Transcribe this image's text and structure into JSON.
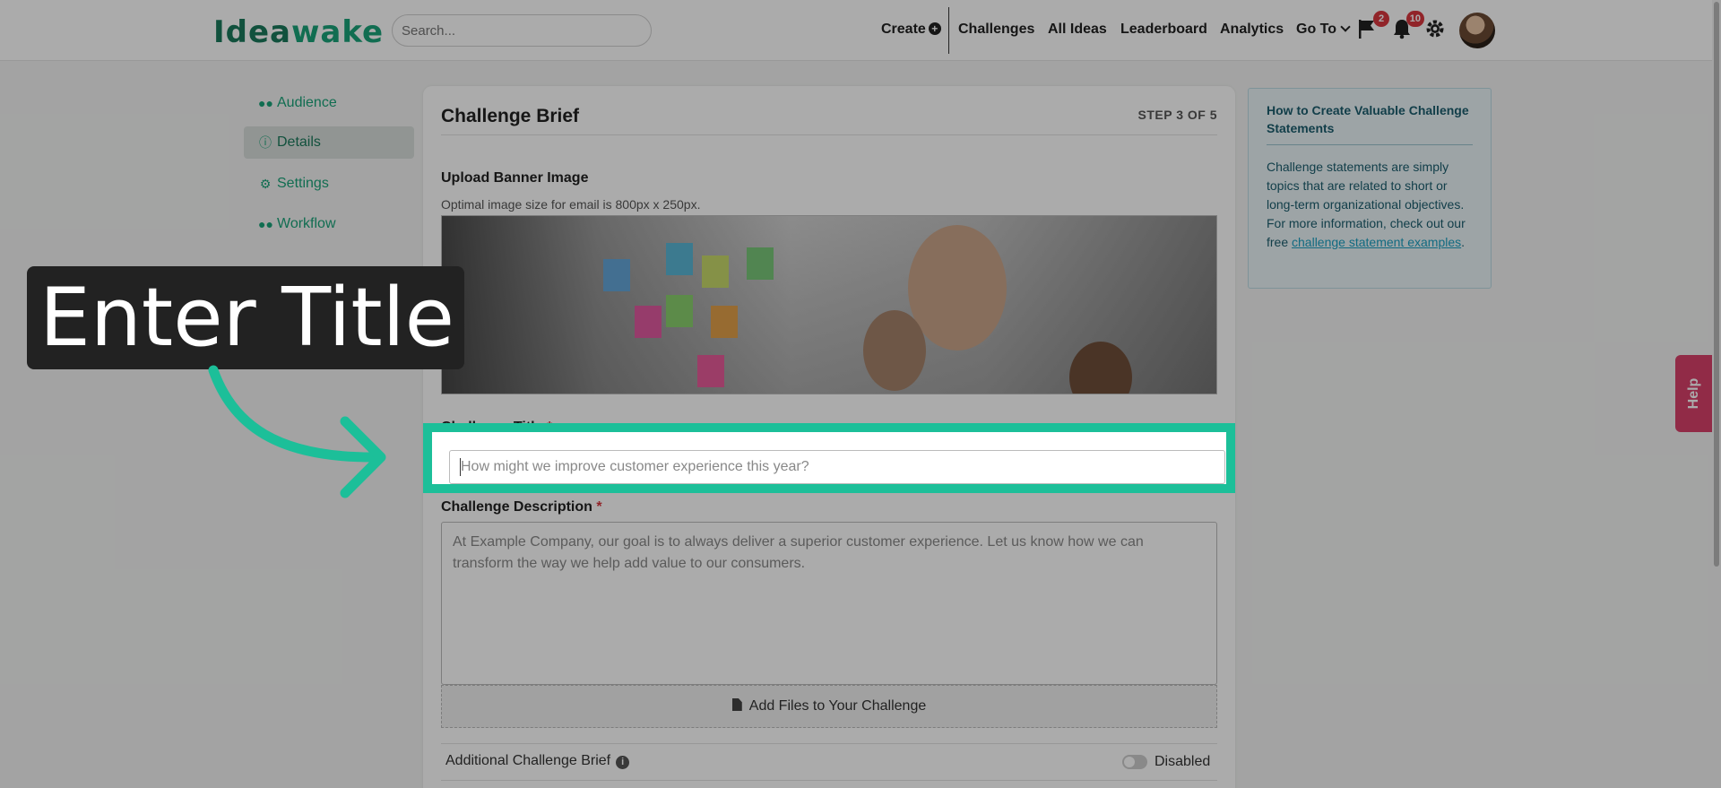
{
  "brand": {
    "logo_text_a": "Idea",
    "logo_text_b": "wake",
    "accent": "#1aa37a",
    "highlight": "#1cbf99"
  },
  "header": {
    "search_placeholder": "Search...",
    "create": "Create",
    "nav": [
      "Challenges",
      "All Ideas",
      "Leaderboard",
      "Analytics"
    ],
    "goto": "Go To",
    "flag_count": "2",
    "bell_count": "10"
  },
  "sidebar": {
    "items": [
      {
        "label": "Audience",
        "icon": "users-icon"
      },
      {
        "label": "Details",
        "icon": "info-icon",
        "active": true
      },
      {
        "label": "Settings",
        "icon": "gear-icon"
      },
      {
        "label": "Workflow",
        "icon": "workflow-icon"
      }
    ]
  },
  "main": {
    "title": "Challenge Brief",
    "step": "STEP 3 OF 5",
    "banner_label": "Upload Banner Image",
    "banner_hint": "Optimal image size for email is 800px x 250px.",
    "title_label": "Challenge Title",
    "title_placeholder": "How might we improve customer experience this year?",
    "description_label": "Challenge Description",
    "required_mark": "*",
    "description_placeholder": "At Example Company, our goal is to always deliver a superior customer experience. Let us know how we can transform the way we help add value to our consumers.",
    "files_label": "Add Files to Your Challenge",
    "additional_label": "Additional Challenge Brief",
    "additional_state": "Disabled"
  },
  "infobox": {
    "heading": "How to Create Valuable Challenge Statements",
    "body": "Challenge statements are simply topics that are related to short or long-term organizational objectives. For more information, check out our free ",
    "link": "challenge statement examples",
    "tail": "."
  },
  "help": {
    "label": "Help"
  },
  "callout": {
    "text": "Enter Title"
  }
}
